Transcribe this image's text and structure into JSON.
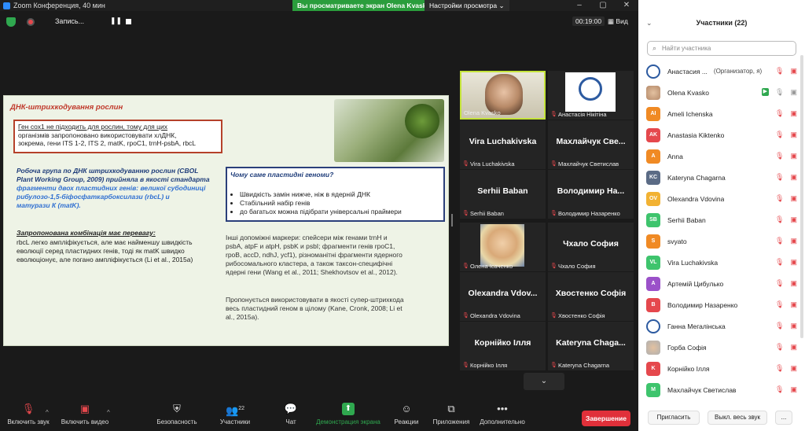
{
  "window": {
    "title": "Zoom Конференция, 40 мин"
  },
  "banner": {
    "sharing": "Вы просматриваете экран Olena Kvasko",
    "view_options": "Настройки просмотра ⌄"
  },
  "recording": {
    "label": "Запись...",
    "pause": "❚❚"
  },
  "meeting": {
    "timer": "00:19:00",
    "view": "Вид"
  },
  "slide": {
    "title": "ДНК-штрихкодування рослин",
    "box1_lines": [
      "Ген cox1 не підходить для рослин, тому для цих",
      "організмів запропоновано використовувати хлДНК,",
      "зокрема, гени ITS 1-2, ITS 2, matK, rpoC1, trnH-psbA, rbcL"
    ],
    "group_lines": [
      "Робоча група по ДНК штрихкодуванню рослин (CBOL",
      "Plant Working Group, 2009) прийняла в якості стандарта",
      "фрагменти двох пластидних генів: великої субодиниці",
      "рибулозо-1,5-біфосфаткарбоксилази (rbcL) и",
      "матурази К (matK)."
    ],
    "combo_head": "Запропонована комбінація має перевагу:",
    "combo_lines": [
      "rbcL легко ампліфікується, але має найменшу швидкість",
      "еволюції серед пластидних генів, тоді як matK швидко",
      "еволюціонує, але погано ампліфікується (Li et al., 2015a)"
    ],
    "box2_title": "Чому саме пластидні геноми?",
    "box2_items": [
      "Швидкість замін нижче, ніж в ядерній ДНК",
      "Стабільний набір генів",
      "до багатьох можна підібрати універсальні праймери"
    ],
    "other_lines": [
      "Інші допоміжні маркери: спейсери між генами trnH и",
      "psbA, atpF и atpH, psbK и psbI; фрагменти генів rpoC1,",
      "rpoB, accD, ndhJ, ycf1), різноманітні фрагменти ядерного",
      "рибосомального кластера, а також таксон-специфічні",
      "ядерні гени (Wang et al., 2011; Shekhovtsov et al., 2012)."
    ],
    "super_lines": [
      "Пропонується використовувати в якості супер-штрихкода",
      "весь пластидний геном в цілому (Kane, Cronk, 2008; Li et",
      "al., 2015a)."
    ]
  },
  "tiles": [
    {
      "name": "",
      "caption": "Olena Kvasko",
      "type": "video1"
    },
    {
      "name": "",
      "caption": "Анастасія Нікітіна",
      "type": "logo"
    },
    {
      "name": "Vira Luchakivska",
      "caption": "Vira Luchakivska",
      "type": "name"
    },
    {
      "name": "Махлайчук Све...",
      "caption": "Махлайчук Светислав",
      "type": "name"
    },
    {
      "name": "Serhii Baban",
      "caption": "Serhii Baban",
      "type": "name"
    },
    {
      "name": "Володимир На...",
      "caption": "Володимир Назаренко",
      "type": "name"
    },
    {
      "name": "",
      "caption": "Олена Ісаченко",
      "type": "video2"
    },
    {
      "name": "Чхало София",
      "caption": "Чхало София",
      "type": "name"
    },
    {
      "name": "Olexandra Vdov...",
      "caption": "Olexandra Vdovina",
      "type": "name"
    },
    {
      "name": "Хвостенко Софія",
      "caption": "Хвостенко Софія",
      "type": "name"
    },
    {
      "name": "Корнійко Ілля",
      "caption": "Корнійко Ілля",
      "type": "name"
    },
    {
      "name": "Kateryna Chaga...",
      "caption": "Kateryna Chagarna",
      "type": "name"
    }
  ],
  "toolbar": {
    "mic": "Включить звук",
    "video": "Включить видео",
    "security": "Безопасность",
    "participants": "Участники",
    "participants_count": "22",
    "chat": "Чат",
    "share": "Демонстрация экрана",
    "reactions": "Реакции",
    "apps": "Приложения",
    "more": "Дополнительно",
    "end": "Завершение"
  },
  "panel": {
    "title": "Участники (22)",
    "search_placeholder": "Найти участника",
    "invite": "Пригласить",
    "mute_all": "Выкл. весь звук",
    "more": "..."
  },
  "participants": [
    {
      "initials": "",
      "color": "#9aa3ad",
      "name": "Анастасия ...",
      "role": "(Организатор, я)",
      "video": "off",
      "special": "logo"
    },
    {
      "initials": "",
      "color": "#b58a6a",
      "name": "Olena Kvasko",
      "role": "",
      "video": "on",
      "special": "photo"
    },
    {
      "initials": "AI",
      "color": "#f08a24",
      "name": "Ameli  Ichenska",
      "role": "",
      "video": "off"
    },
    {
      "initials": "AK",
      "color": "#e5484d",
      "name": "Anastasia Kiktenko",
      "role": "",
      "video": "off"
    },
    {
      "initials": "A",
      "color": "#f08a24",
      "name": "Anna",
      "role": "",
      "video": "off"
    },
    {
      "initials": "KC",
      "color": "#5b6b85",
      "name": "Kateryna Chagarna",
      "role": "",
      "video": "off"
    },
    {
      "initials": "OV",
      "color": "#f2b233",
      "name": "Olexandra Vdovina",
      "role": "",
      "video": "off"
    },
    {
      "initials": "SB",
      "color": "#3ec46d",
      "name": "Serhii Baban",
      "role": "",
      "video": "off"
    },
    {
      "initials": "S",
      "color": "#f08a24",
      "name": "svyato",
      "role": "",
      "video": "off"
    },
    {
      "initials": "VL",
      "color": "#3ec46d",
      "name": "Vira Luchakivska",
      "role": "",
      "video": "off"
    },
    {
      "initials": "A",
      "color": "#9b51c9",
      "name": "Артемій Цибулько",
      "role": "",
      "video": "off"
    },
    {
      "initials": "B",
      "color": "#e5484d",
      "name": "Володимир Назаренко",
      "role": "",
      "video": "off"
    },
    {
      "initials": "",
      "color": "#9aa3ad",
      "name": "Ганна Мегалінська",
      "role": "",
      "video": "off",
      "special": "logo"
    },
    {
      "initials": "",
      "color": "#b0b0b0",
      "name": "Горба Софія",
      "role": "",
      "video": "off",
      "special": "photo"
    },
    {
      "initials": "K",
      "color": "#e5484d",
      "name": "Корнійко Ілля",
      "role": "",
      "video": "off"
    },
    {
      "initials": "M",
      "color": "#3ec46d",
      "name": "Махлайчук Светислав",
      "role": "",
      "video": "off"
    }
  ]
}
